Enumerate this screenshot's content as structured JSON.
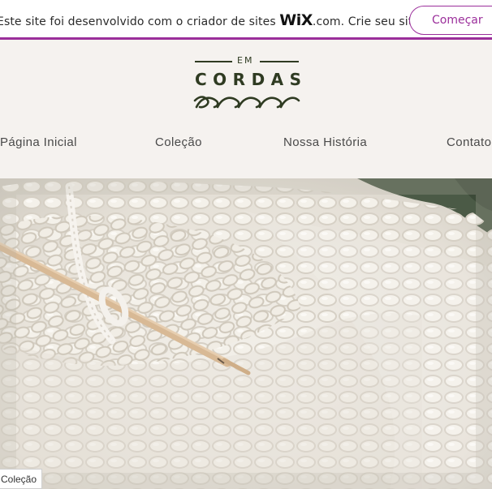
{
  "wix_banner": {
    "text_before": "Este site foi desenvolvido com o criador de sites ",
    "logo": "WiX",
    "text_after": ".com. Crie seu site hoje.",
    "button_label": "Começar",
    "accent_color": "#9b2f9b"
  },
  "header": {
    "logo_small": "EM",
    "logo_title": "CORDAS",
    "nav": [
      "Página Inicial",
      "Coleção",
      "Nossa História",
      "Contato"
    ]
  },
  "hero": {
    "image": "crochet-hook-on-chenille-yarn-blanket",
    "label": "Coleção"
  },
  "colors": {
    "header_bg": "#f5f2ef",
    "logo_green": "#2f3b22"
  }
}
